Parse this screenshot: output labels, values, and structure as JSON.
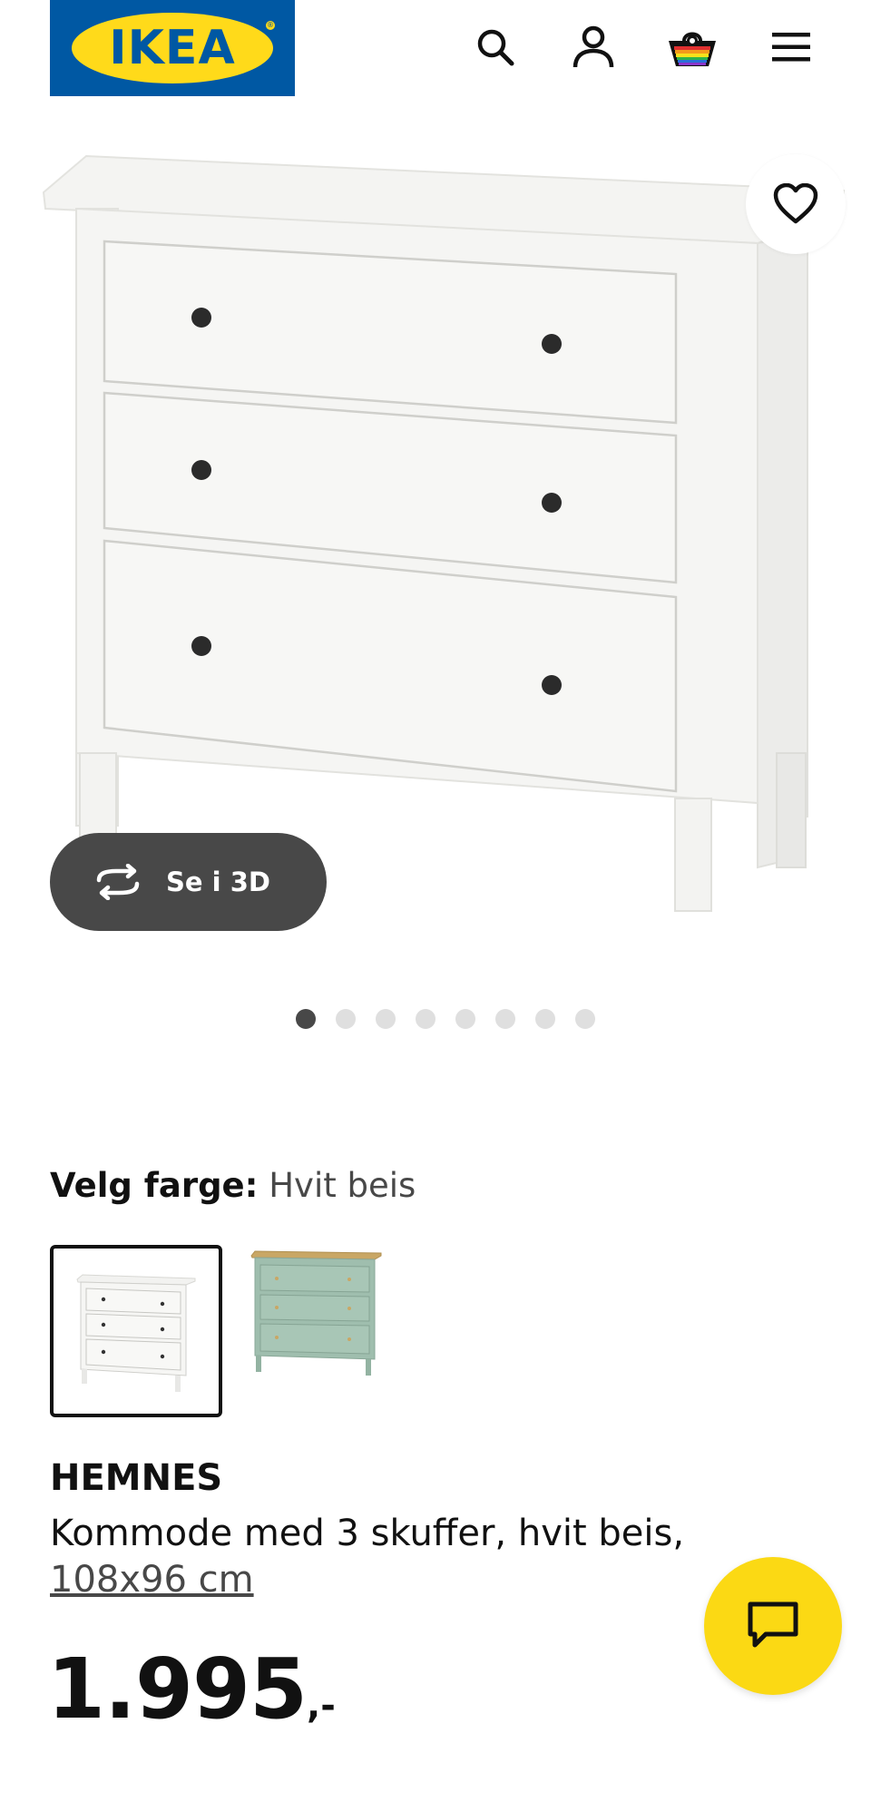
{
  "header": {
    "logo_text": "IKEA",
    "logo_registered": "®",
    "icons": [
      "search-icon",
      "user-icon",
      "shopping-bag-icon",
      "menu-icon"
    ]
  },
  "gallery": {
    "view_3d_label": "Se i 3D",
    "dot_count": 8,
    "active_index": 0
  },
  "color_select": {
    "label": "Velg farge:",
    "selected_value": "Hvit beis",
    "swatches": [
      "white-beige-chest",
      "green-chest"
    ]
  },
  "product": {
    "name": "HEMNES",
    "description": "Kommode med 3 skuffer, hvit beis,",
    "size": "108x96 cm",
    "price_integer": "1.995",
    "price_suffix": ",-"
  },
  "colors": {
    "ikea_blue": "#0058a3",
    "ikea_yellow": "#ffda1a",
    "chat_yellow": "#fbd914",
    "dark_grey": "#484848"
  }
}
